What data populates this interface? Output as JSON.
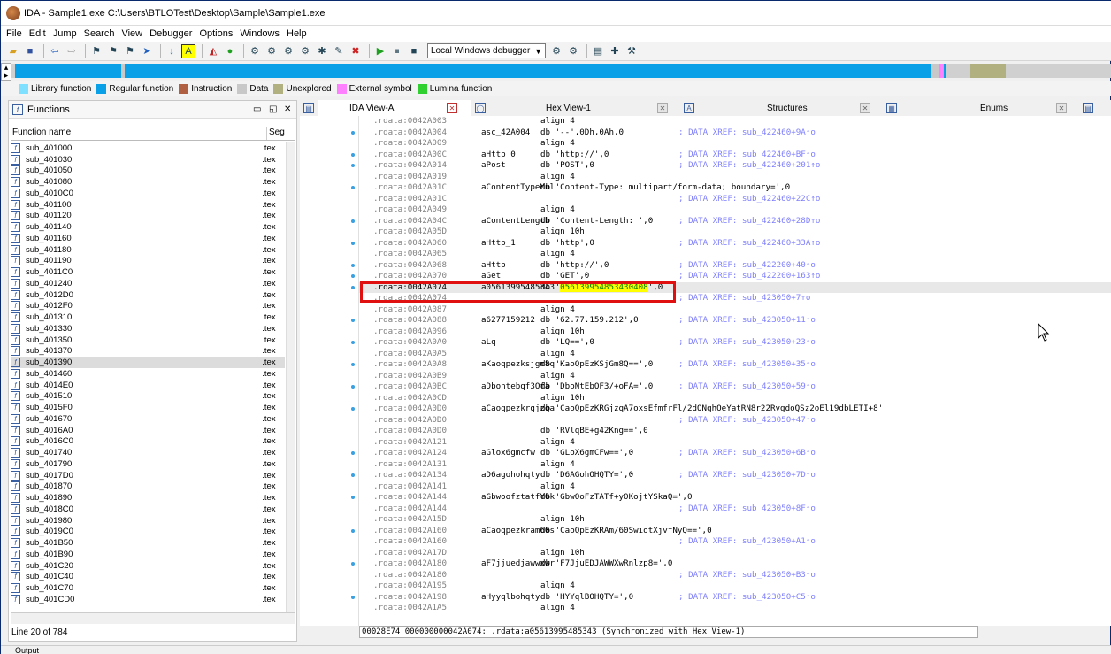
{
  "window": {
    "title": "IDA - Sample1.exe C:\\Users\\BTLOTest\\Desktop\\Sample\\Sample1.exe"
  },
  "menu": [
    "File",
    "Edit",
    "Jump",
    "Search",
    "View",
    "Debugger",
    "Options",
    "Windows",
    "Help"
  ],
  "toolbar": {
    "debugger_select": "Local Windows debugger"
  },
  "legend": [
    {
      "label": "Library function",
      "color": "#80e0ff"
    },
    {
      "label": "Regular function",
      "color": "#0aa0e8"
    },
    {
      "label": "Instruction",
      "color": "#b06040"
    },
    {
      "label": "Data",
      "color": "#c8c8c8"
    },
    {
      "label": "Unexplored",
      "color": "#b0b080"
    },
    {
      "label": "External symbol",
      "color": "#ff80ff"
    },
    {
      "label": "Lumina function",
      "color": "#30d030"
    }
  ],
  "functions_panel": {
    "title": "Functions",
    "col_name": "Function name",
    "col_seg": "Seg",
    "line_status": "Line 20 of 784",
    "items": [
      {
        "name": "sub_401000",
        "seg": ".tex"
      },
      {
        "name": "sub_401030",
        "seg": ".tex"
      },
      {
        "name": "sub_401050",
        "seg": ".tex"
      },
      {
        "name": "sub_401080",
        "seg": ".tex"
      },
      {
        "name": "sub_4010C0",
        "seg": ".tex"
      },
      {
        "name": "sub_401100",
        "seg": ".tex"
      },
      {
        "name": "sub_401120",
        "seg": ".tex"
      },
      {
        "name": "sub_401140",
        "seg": ".tex"
      },
      {
        "name": "sub_401160",
        "seg": ".tex"
      },
      {
        "name": "sub_401180",
        "seg": ".tex"
      },
      {
        "name": "sub_401190",
        "seg": ".tex"
      },
      {
        "name": "sub_4011C0",
        "seg": ".tex"
      },
      {
        "name": "sub_401240",
        "seg": ".tex"
      },
      {
        "name": "sub_4012D0",
        "seg": ".tex"
      },
      {
        "name": "sub_4012F0",
        "seg": ".tex"
      },
      {
        "name": "sub_401310",
        "seg": ".tex"
      },
      {
        "name": "sub_401330",
        "seg": ".tex"
      },
      {
        "name": "sub_401350",
        "seg": ".tex"
      },
      {
        "name": "sub_401370",
        "seg": ".tex"
      },
      {
        "name": "sub_401390",
        "seg": ".tex"
      },
      {
        "name": "sub_401460",
        "seg": ".tex"
      },
      {
        "name": "sub_4014E0",
        "seg": ".tex"
      },
      {
        "name": "sub_401510",
        "seg": ".tex"
      },
      {
        "name": "sub_4015F0",
        "seg": ".tex"
      },
      {
        "name": "sub_401670",
        "seg": ".tex"
      },
      {
        "name": "sub_4016A0",
        "seg": ".tex"
      },
      {
        "name": "sub_4016C0",
        "seg": ".tex"
      },
      {
        "name": "sub_401740",
        "seg": ".tex"
      },
      {
        "name": "sub_401790",
        "seg": ".tex"
      },
      {
        "name": "sub_4017D0",
        "seg": ".tex"
      },
      {
        "name": "sub_401870",
        "seg": ".tex"
      },
      {
        "name": "sub_401890",
        "seg": ".tex"
      },
      {
        "name": "sub_4018C0",
        "seg": ".tex"
      },
      {
        "name": "sub_401980",
        "seg": ".tex"
      },
      {
        "name": "sub_4019C0",
        "seg": ".tex"
      },
      {
        "name": "sub_401B50",
        "seg": ".tex"
      },
      {
        "name": "sub_401B90",
        "seg": ".tex"
      },
      {
        "name": "sub_401C20",
        "seg": ".tex"
      },
      {
        "name": "sub_401C40",
        "seg": ".tex"
      },
      {
        "name": "sub_401C70",
        "seg": ".tex"
      },
      {
        "name": "sub_401CD0",
        "seg": ".tex"
      }
    ]
  },
  "tabs": [
    {
      "label": "IDA View-A"
    },
    {
      "label": "Hex View-1"
    },
    {
      "label": "Structures"
    },
    {
      "label": "Enums"
    }
  ],
  "disasm": [
    {
      "addr": ".rdata:0042A003",
      "lbl": "",
      "ins": "align 4",
      "cmt": ""
    },
    {
      "addr": ".rdata:0042A004",
      "lbl": "asc_42A004",
      "ins": "db '--',0Dh,0Ah,0",
      "cmt": "; DATA XREF: sub_422460+9A↑o"
    },
    {
      "addr": ".rdata:0042A009",
      "lbl": "",
      "ins": "align 4",
      "cmt": ""
    },
    {
      "addr": ".rdata:0042A00C",
      "lbl": "aHttp_0",
      "ins": "db 'http://',0",
      "cmt": "; DATA XREF: sub_422460+BF↑o"
    },
    {
      "addr": ".rdata:0042A014",
      "lbl": "aPost",
      "ins": "db 'POST',0",
      "cmt": "; DATA XREF: sub_422460+201↑o"
    },
    {
      "addr": ".rdata:0042A019",
      "lbl": "",
      "ins": "align 4",
      "cmt": ""
    },
    {
      "addr": ".rdata:0042A01C",
      "lbl": "aContentTypeMul",
      "ins": "db 'Content-Type: multipart/form-data; boundary=',0",
      "cmt": ""
    },
    {
      "addr": ".rdata:0042A01C",
      "lbl": "",
      "ins": "",
      "cmt": "; DATA XREF: sub_422460+22C↑o"
    },
    {
      "addr": ".rdata:0042A049",
      "lbl": "",
      "ins": "align 4",
      "cmt": ""
    },
    {
      "addr": ".rdata:0042A04C",
      "lbl": "aContentLength",
      "ins": "db 'Content-Length: ',0",
      "cmt": "; DATA XREF: sub_422460+28D↑o"
    },
    {
      "addr": ".rdata:0042A05D",
      "lbl": "",
      "ins": "align 10h",
      "cmt": ""
    },
    {
      "addr": ".rdata:0042A060",
      "lbl": "aHttp_1",
      "ins": "db 'http',0",
      "cmt": "; DATA XREF: sub_422460+33A↑o"
    },
    {
      "addr": ".rdata:0042A065",
      "lbl": "",
      "ins": "align 4",
      "cmt": ""
    },
    {
      "addr": ".rdata:0042A068",
      "lbl": "aHttp",
      "ins": "db 'http://',0",
      "cmt": "; DATA XREF: sub_422200+40↑o"
    },
    {
      "addr": ".rdata:0042A070",
      "lbl": "aGet",
      "ins": "db 'GET',0",
      "cmt": "; DATA XREF: sub_422200+163↑o"
    },
    {
      "addr": ".rdata:0042A074",
      "lbl": "a05613995485343",
      "ins": "db '056139954853430408',0",
      "cmt": "",
      "highlight": "056139954853430408"
    },
    {
      "addr": ".rdata:0042A074",
      "lbl": "",
      "ins": "",
      "cmt": "; DATA XREF: sub_423050+7↑o"
    },
    {
      "addr": ".rdata:0042A087",
      "lbl": "",
      "ins": "align 4",
      "cmt": ""
    },
    {
      "addr": ".rdata:0042A088",
      "lbl": "a6277159212",
      "ins": "db '62.77.159.212',0",
      "cmt": "; DATA XREF: sub_423050+11↑o"
    },
    {
      "addr": ".rdata:0042A096",
      "lbl": "",
      "ins": "align 10h",
      "cmt": ""
    },
    {
      "addr": ".rdata:0042A0A0",
      "lbl": "aLq",
      "ins": "db 'LQ==',0",
      "cmt": "; DATA XREF: sub_423050+23↑o"
    },
    {
      "addr": ".rdata:0042A0A5",
      "lbl": "",
      "ins": "align 4",
      "cmt": ""
    },
    {
      "addr": ".rdata:0042A0A8",
      "lbl": "aKaoqpezksjgm8q",
      "ins": "db 'KaoQpEzKSjGm8Q==',0",
      "cmt": "; DATA XREF: sub_423050+35↑o"
    },
    {
      "addr": ".rdata:0042A0B9",
      "lbl": "",
      "ins": "align 4",
      "cmt": ""
    },
    {
      "addr": ".rdata:0042A0BC",
      "lbl": "aDbontebqf3Ofa",
      "ins": "db 'DboNtEbQF3/+oFA=',0",
      "cmt": "; DATA XREF: sub_423050+59↑o"
    },
    {
      "addr": ".rdata:0042A0CD",
      "lbl": "",
      "ins": "align 10h",
      "cmt": ""
    },
    {
      "addr": ".rdata:0042A0D0",
      "lbl": "aCaoqpezkrgjzqa",
      "ins": "db 'CaoQpEzKRGjzqA7oxsEfmfrFl/2dONghOeYatRN8r22RvgdoQSz2oEl19dbLETI+8'",
      "cmt": ""
    },
    {
      "addr": ".rdata:0042A0D0",
      "lbl": "",
      "ins": "",
      "cmt": "; DATA XREF: sub_423050+47↑o"
    },
    {
      "addr": ".rdata:0042A0D0",
      "lbl": "",
      "ins": "db 'RVlqBE+g42Kng==',0",
      "cmt": ""
    },
    {
      "addr": ".rdata:0042A121",
      "lbl": "",
      "ins": "align 4",
      "cmt": ""
    },
    {
      "addr": ".rdata:0042A124",
      "lbl": "aGlox6gmcfw",
      "ins": "db 'GLoX6gmCFw==',0",
      "cmt": "; DATA XREF: sub_423050+6B↑o"
    },
    {
      "addr": ".rdata:0042A131",
      "lbl": "",
      "ins": "align 4",
      "cmt": ""
    },
    {
      "addr": ".rdata:0042A134",
      "lbl": "aD6agohohqty",
      "ins": "db 'D6AGohOHQTY=',0",
      "cmt": "; DATA XREF: sub_423050+7D↑o"
    },
    {
      "addr": ".rdata:0042A141",
      "lbl": "",
      "ins": "align 4",
      "cmt": ""
    },
    {
      "addr": ".rdata:0042A144",
      "lbl": "aGbwoofztatfY0k",
      "ins": "db 'GbwOoFzTATf+y0KojtYSkaQ=',0",
      "cmt": ""
    },
    {
      "addr": ".rdata:0042A144",
      "lbl": "",
      "ins": "",
      "cmt": "; DATA XREF: sub_423050+8F↑o"
    },
    {
      "addr": ".rdata:0042A15D",
      "lbl": "",
      "ins": "align 10h",
      "cmt": ""
    },
    {
      "addr": ".rdata:0042A160",
      "lbl": "aCaoqpezkram60s",
      "ins": "db 'CaoQpEzKRAm/60SwiotXjvfNyQ==',0",
      "cmt": ""
    },
    {
      "addr": ".rdata:0042A160",
      "lbl": "",
      "ins": "",
      "cmt": "; DATA XREF: sub_423050+A1↑o"
    },
    {
      "addr": ".rdata:0042A17D",
      "lbl": "",
      "ins": "align 10h",
      "cmt": ""
    },
    {
      "addr": ".rdata:0042A180",
      "lbl": "aF7jjuedjawwxwr",
      "ins": "db 'F7JjuEDJAWWXwRnlzp8=',0",
      "cmt": ""
    },
    {
      "addr": ".rdata:0042A180",
      "lbl": "",
      "ins": "",
      "cmt": "; DATA XREF: sub_423050+B3↑o"
    },
    {
      "addr": ".rdata:0042A195",
      "lbl": "",
      "ins": "align 4",
      "cmt": ""
    },
    {
      "addr": ".rdata:0042A198",
      "lbl": "aHyyqlbohqty",
      "ins": "db 'HYYqlBOHQTY=',0",
      "cmt": "; DATA XREF: sub_423050+C5↑o"
    },
    {
      "addr": ".rdata:0042A1A5",
      "lbl": "",
      "ins": "align 4",
      "cmt": ""
    }
  ],
  "status": {
    "text": "00028E74 000000000042A074: .rdata:a05613995485343 (Synchronized with Hex View-1)"
  },
  "output": {
    "label": "Output"
  }
}
